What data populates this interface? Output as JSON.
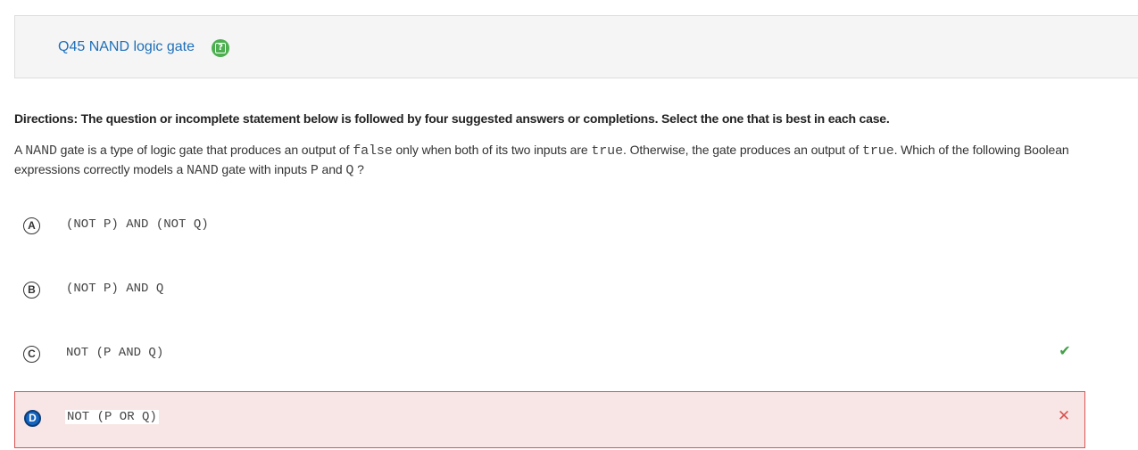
{
  "question": {
    "title": "Q45 NAND logic gate",
    "help_icon": "help-icon"
  },
  "directions": "Directions: The question or incomplete statement below is followed by four suggested answers or completions. Select the one that is best in each case.",
  "stem": {
    "part1": "A ",
    "code1": "NAND",
    "part2": " gate is a type of logic gate that produces an output of ",
    "code2": "false",
    "part3": " only when both of its two inputs are ",
    "code3": "true",
    "part4": ". Otherwise, the gate produces an output of ",
    "code4": "true",
    "part5": ". Which of the following Boolean expressions correctly models a ",
    "code5": "NAND",
    "part6": " gate with inputs ",
    "code6": "P",
    "part7": " and ",
    "code7": "Q",
    "part8": " ?"
  },
  "options": [
    {
      "letter": "A",
      "text": "(NOT P) AND (NOT Q)",
      "status": "none"
    },
    {
      "letter": "B",
      "text": "(NOT P) AND Q",
      "status": "none"
    },
    {
      "letter": "C",
      "text": "NOT (P AND Q)",
      "status": "correct",
      "mark_icon": "checkmark-icon"
    },
    {
      "letter": "D",
      "text": "NOT (P OR Q)",
      "status": "selected-incorrect",
      "mark_icon": "cross-icon"
    }
  ],
  "colors": {
    "link": "#1e6fb8",
    "help": "#4caf50",
    "correct": "#43a047",
    "incorrect": "#d9534f",
    "selected_badge": "#1565c0",
    "incorrect_bg": "#f8e6e6"
  }
}
